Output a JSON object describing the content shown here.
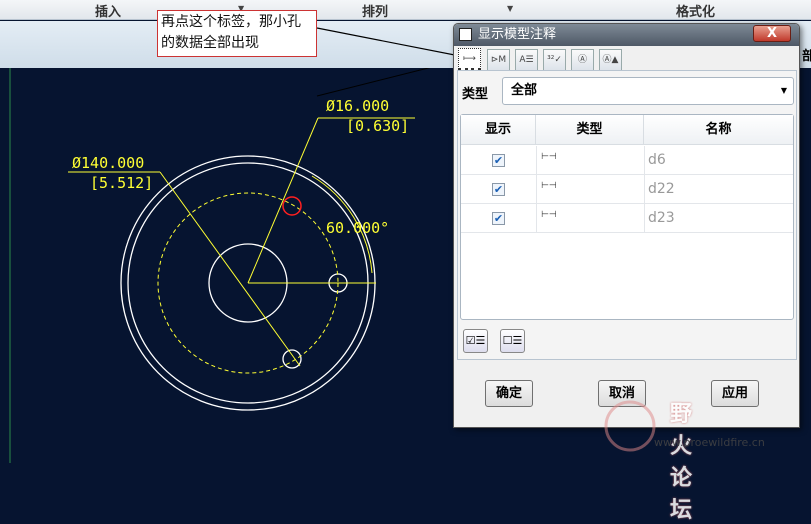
{
  "menubar": {
    "items": [
      "插入",
      "排列",
      "格式化"
    ],
    "partial_label": "部"
  },
  "callout": {
    "text": "再点这个标签，那小孔的数据全部出现"
  },
  "drawing": {
    "dim_diameter_large": "Ø140.000",
    "dim_diameter_large_alt": "[5.512]",
    "dim_diameter_small": "Ø16.000",
    "dim_diameter_small_alt": "[0.630]",
    "dim_angle": "60.000°",
    "colors": {
      "background": "#061430",
      "geometry": "#ffffff",
      "dims": "#ffff33",
      "highlight": "#ff2020"
    }
  },
  "dialog": {
    "title": "显示模型注释",
    "close_label": "X",
    "tabs": [
      "尺寸",
      "形位公差",
      "注释",
      "表面粗糙度",
      "符号",
      "基准"
    ],
    "type_label": "类型",
    "type_value": "全部",
    "columns": [
      "显示",
      "类型",
      "名称"
    ],
    "rows": [
      {
        "checked": true,
        "name": "d6"
      },
      {
        "checked": true,
        "name": "d22"
      },
      {
        "checked": true,
        "name": "d23"
      }
    ],
    "select_all_icon": "select-all-icon",
    "deselect_all_icon": "deselect-all-icon",
    "buttons": {
      "ok": "确定",
      "cancel": "取消",
      "apply": "应用"
    }
  },
  "watermark": {
    "text": "野火论坛",
    "url": "www.proewildfire.cn"
  }
}
